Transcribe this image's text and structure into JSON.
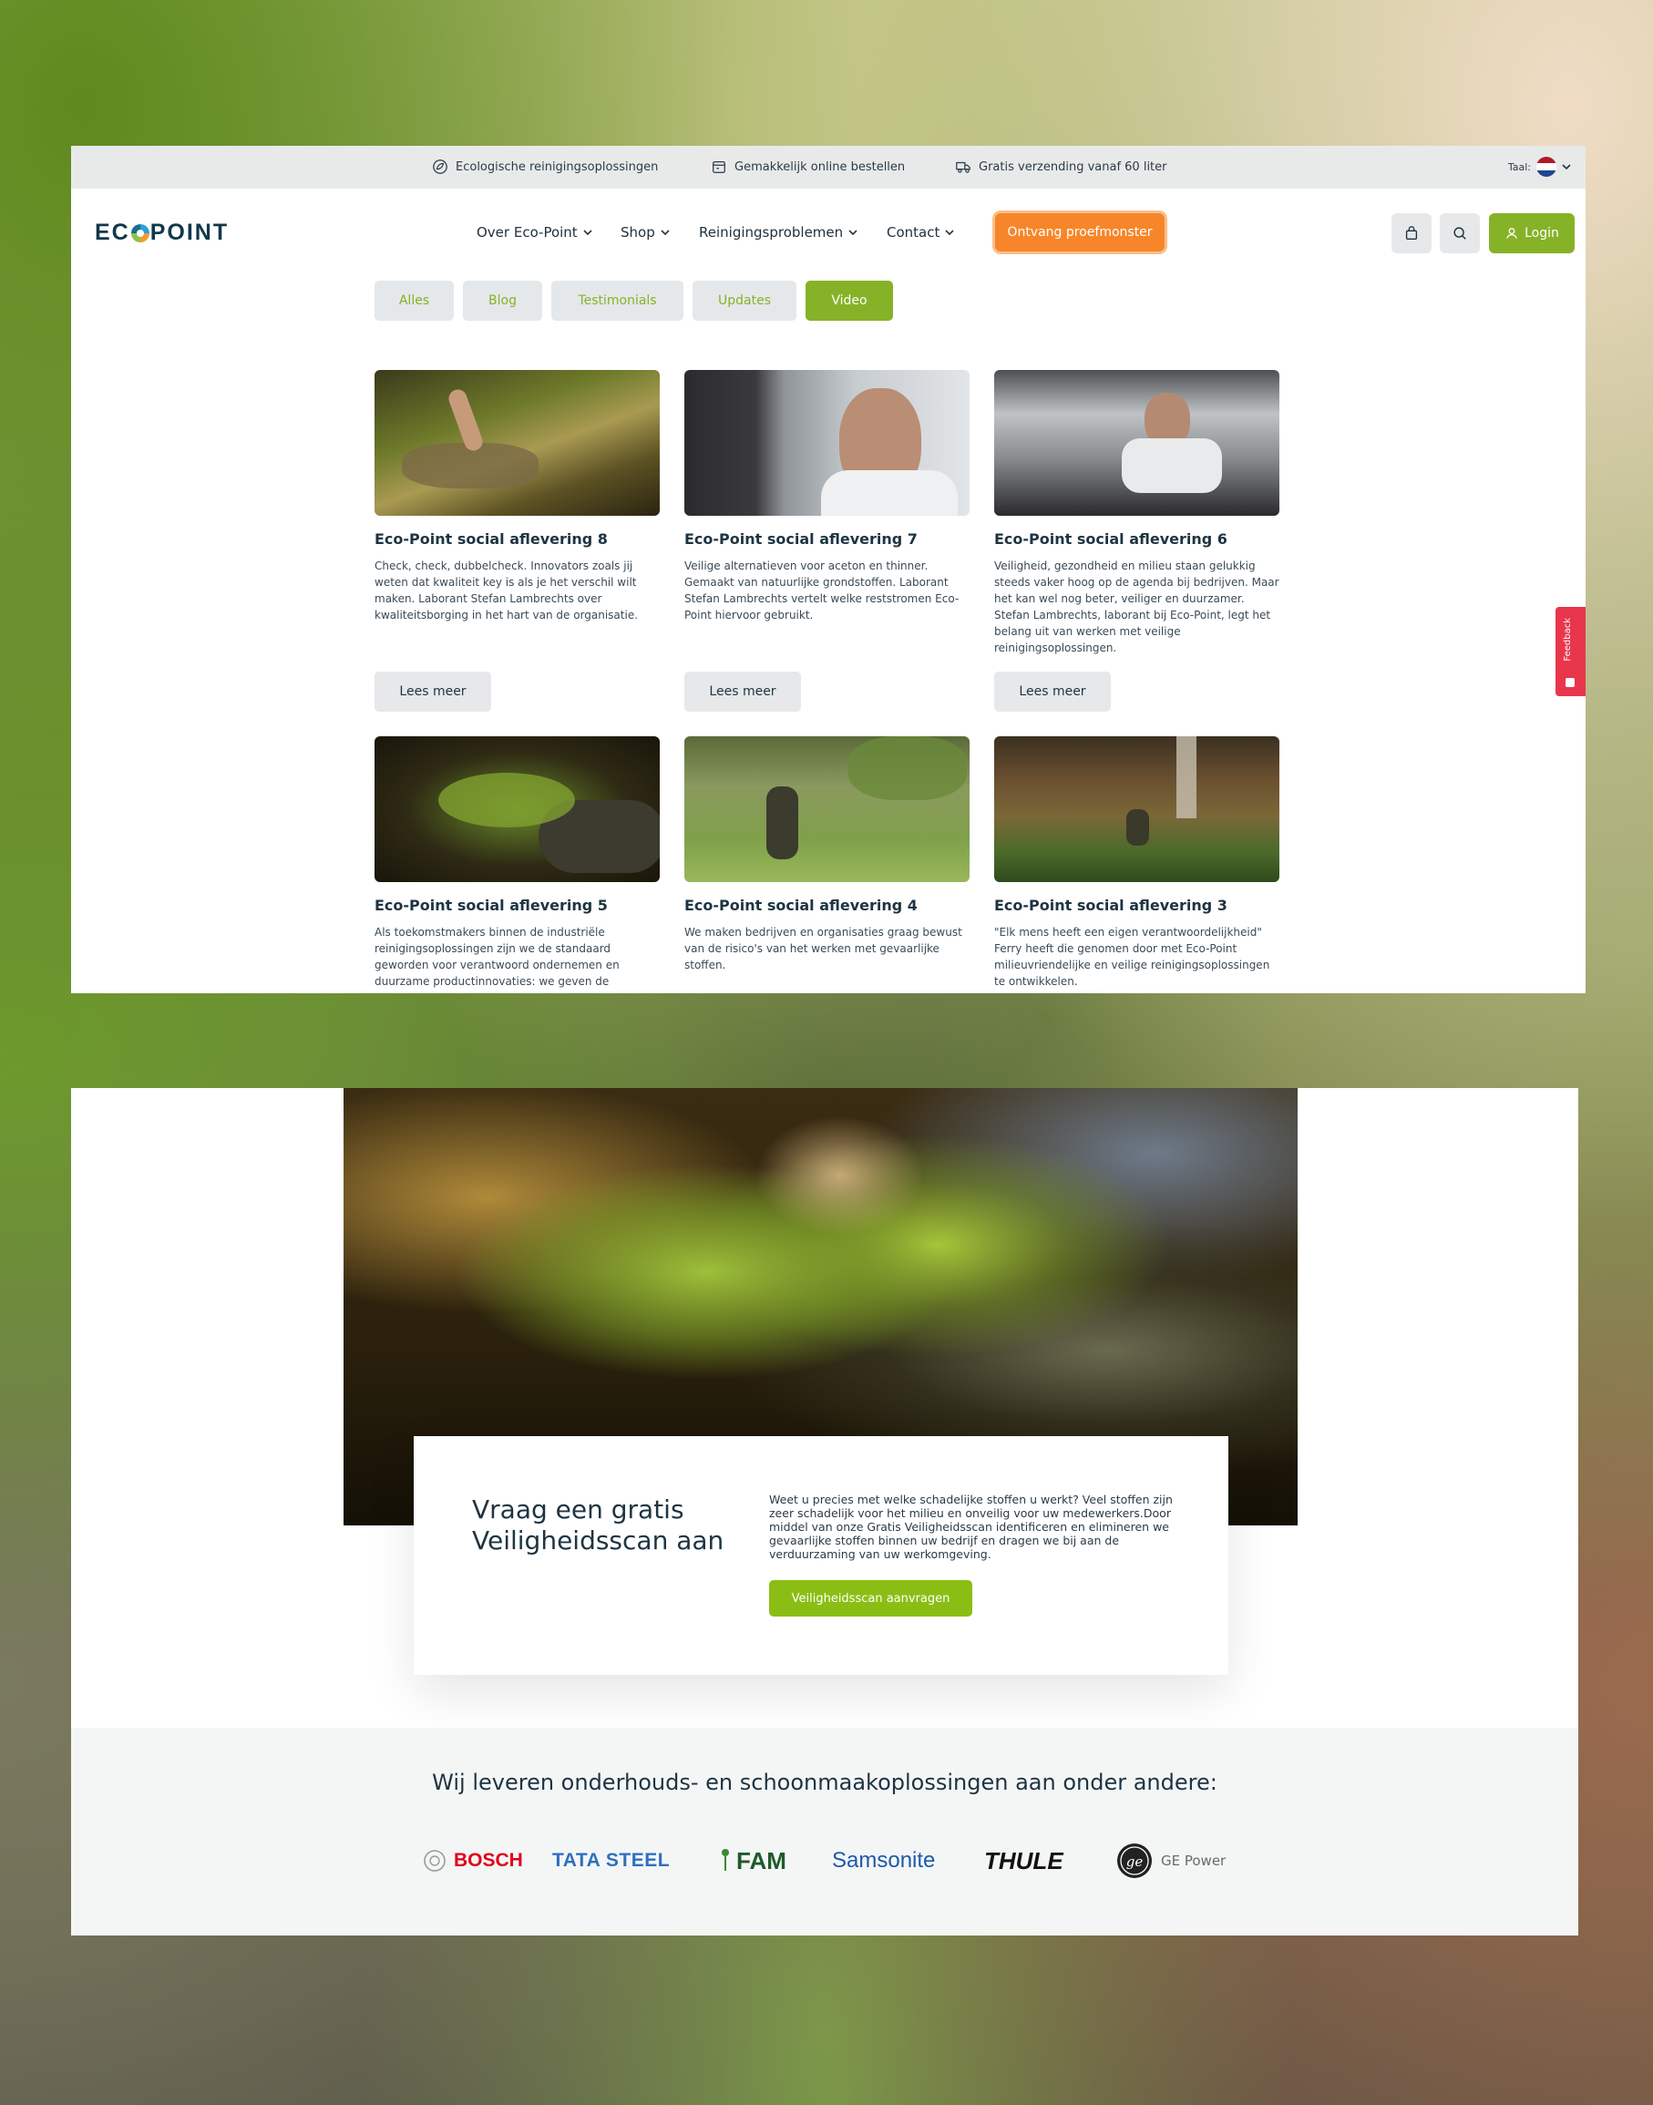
{
  "topbar": {
    "usps": [
      "Ecologische reinigingsoplossingen",
      "Gemakkelijk online bestellen",
      "Gratis verzending vanaf 60 liter"
    ],
    "lang_label": "Taal:"
  },
  "brand": {
    "logo_left": "EC",
    "logo_right": "POINT",
    "accent": "#86b228",
    "orange": "#f7862a"
  },
  "nav": {
    "items": [
      "Over Eco-Point",
      "Shop",
      "Reinigingsproblemen",
      "Contact"
    ],
    "cta": "Ontvang proefmonster",
    "login": "Login"
  },
  "filters": {
    "tabs": [
      "Alles",
      "Blog",
      "Testimonials",
      "Updates",
      "Video"
    ],
    "active": "Video"
  },
  "articles": [
    {
      "title": "Eco-Point social aflevering 8",
      "text": "Check, check, dubbelcheck. Innovators zoals jij weten dat kwaliteit key is als je het verschil wilt maken. Laborant Stefan Lambrechts over kwaliteitsborging in het hart van de organisatie.",
      "button": "Lees meer"
    },
    {
      "title": "Eco-Point social aflevering 7",
      "text": "Veilige alternatieven voor aceton en thinner. Gemaakt van natuurlijke grondstoffen. Laborant Stefan Lambrechts vertelt welke reststromen Eco-Point hiervoor gebruikt.",
      "button": "Lees meer"
    },
    {
      "title": "Eco-Point social aflevering 6",
      "text": "Veiligheid, gezondheid en milieu staan gelukkig steeds vaker hoog op de agenda bij bedrijven. Maar het kan wel nog beter, veiliger en duurzamer. Stefan Lambrechts, laborant bij Eco-Point, legt het belang uit van werken met veilige reinigingsoplossingen.",
      "button": "Lees meer"
    },
    {
      "title": "Eco-Point social aflevering 5",
      "text": "Als toekomstmakers binnen de industriële reinigingsoplossingen zijn we de standaard geworden voor verantwoord ondernemen en duurzame productinnovaties: we geven de"
    },
    {
      "title": "Eco-Point social aflevering 4",
      "text": "We maken bedrijven en organisaties graag bewust van de risico's van het werken met gevaarlijke stoffen."
    },
    {
      "title": "Eco-Point social aflevering 3",
      "text": "\"Elk mens heeft een eigen verantwoordelijkheid\" Ferry heeft die genomen door met Eco-Point milieuvriendelijke en veilige reinigingsoplossingen te ontwikkelen."
    }
  ],
  "feedback": "Feedback",
  "scan": {
    "title": "Vraag een gratis Veiligheidsscan aan",
    "text": "Weet u precies met welke schadelijke stoffen u werkt? Veel stoffen zijn zeer schadelijk voor het milieu en onveilig voor uw medewerkers.Door middel van onze Gratis Veiligheidsscan identificeren en elimineren we gevaarlijke stoffen binnen uw bedrijf en dragen we bij aan de verduurzaming van uw werkomgeving.",
    "button": "Veiligheidsscan aanvragen"
  },
  "clients": {
    "heading": "Wij leveren onderhouds- en schoonmaakoplossingen aan onder andere:",
    "logos": [
      "BOSCH",
      "TATA STEEL",
      "FAM",
      "Samsonite",
      "THULE",
      "GE Power"
    ]
  }
}
